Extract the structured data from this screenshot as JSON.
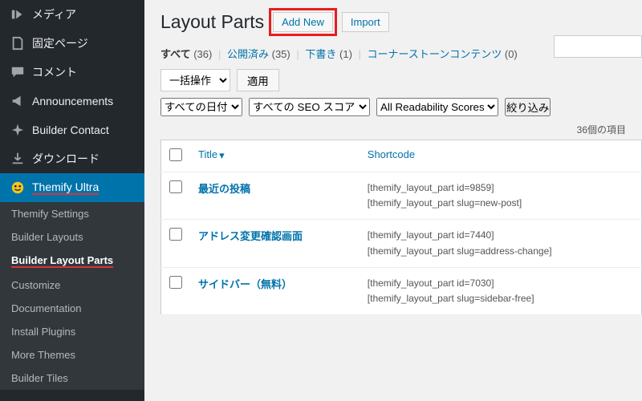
{
  "sidebar": {
    "items": [
      {
        "label": "メディア",
        "icon": "media"
      },
      {
        "label": "固定ページ",
        "icon": "page"
      },
      {
        "label": "コメント",
        "icon": "comment"
      },
      {
        "label": "Announcements",
        "icon": "megaphone"
      },
      {
        "label": "Builder Contact",
        "icon": "pin"
      },
      {
        "label": "ダウンロード",
        "icon": "download"
      },
      {
        "label": "Themify Ultra",
        "icon": "themify"
      }
    ],
    "submenu": [
      {
        "label": "Themify Settings"
      },
      {
        "label": "Builder Layouts"
      },
      {
        "label": "Builder Layout Parts",
        "current": true
      },
      {
        "label": "Customize"
      },
      {
        "label": "Documentation"
      },
      {
        "label": "Install Plugins"
      },
      {
        "label": "More Themes"
      },
      {
        "label": "Builder Tiles"
      }
    ]
  },
  "header": {
    "title": "Layout Parts",
    "add_new": "Add New",
    "import": "Import"
  },
  "subsub": {
    "all_label": "すべて",
    "all_count": "(36)",
    "published_label": "公開済み",
    "published_count": "(35)",
    "draft_label": "下書き",
    "draft_count": "(1)",
    "cornerstone_label": "コーナーストーンコンテンツ",
    "cornerstone_count": "(0)"
  },
  "filters": {
    "bulk": "一括操作",
    "apply": "適用",
    "all_dates": "すべての日付",
    "seo": "すべての SEO スコア",
    "readability": "All Readability Scores",
    "narrow": "絞り込み"
  },
  "itemcount": "36個の項目",
  "columns": {
    "title": "Title",
    "shortcode": "Shortcode"
  },
  "rows": [
    {
      "title": "最近の投稿",
      "short1": "[themify_layout_part id=9859]",
      "short2": "[themify_layout_part slug=new-post]"
    },
    {
      "title": "アドレス変更確認画面",
      "short1": "[themify_layout_part id=7440]",
      "short2": "[themify_layout_part slug=address-change]"
    },
    {
      "title": "サイドバー（無料）",
      "short1": "[themify_layout_part id=7030]",
      "short2": "[themify_layout_part slug=sidebar-free]"
    }
  ]
}
